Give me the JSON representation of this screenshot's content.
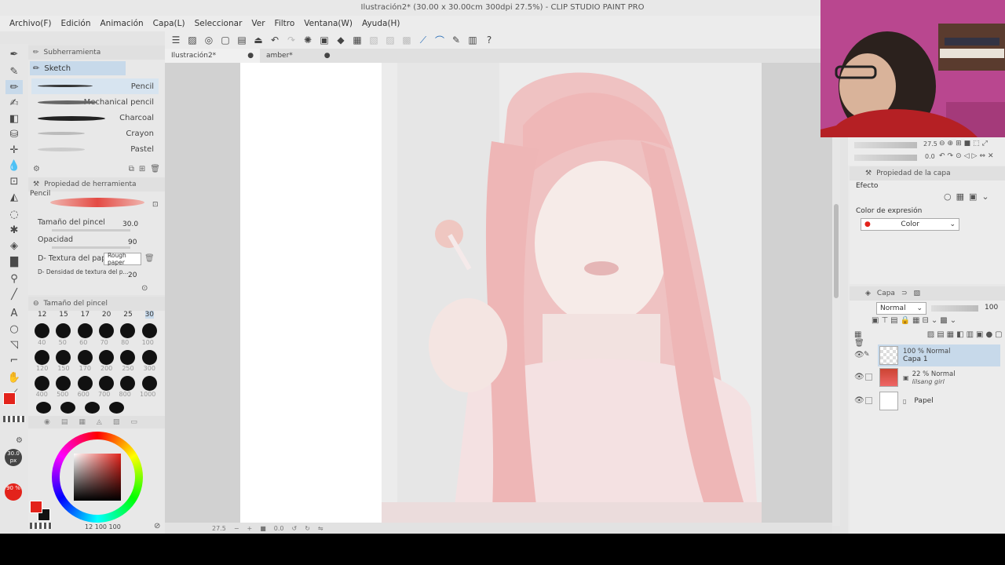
{
  "window": {
    "title": "Ilustración2* (30.00 x 30.00cm 300dpi 27.5%)  - CLIP STUDIO PAINT PRO"
  },
  "menu": [
    "Archivo(F)",
    "Edición",
    "Animación",
    "Capa(L)",
    "Seleccionar",
    "Ver",
    "Filtro",
    "Ventana(W)",
    "Ayuda(H)"
  ],
  "doc_tabs": [
    {
      "label": "Ilustración2*",
      "active": true
    },
    {
      "label": "amber*",
      "active": false
    }
  ],
  "subtool": {
    "header": "Subherramienta",
    "group": "Sketch",
    "brushes": [
      "Pencil",
      "Mechanical pencil",
      "Charcoal",
      "Crayon",
      "Pastel"
    ],
    "selected": "Pencil"
  },
  "tool_property": {
    "header": "Propiedad de herramienta",
    "tool_name": "Pencil",
    "brush_size_label": "Tamaño del pincel",
    "brush_size_value": "30.0",
    "opacity_label": "Opacidad",
    "opacity_value": "90",
    "texture_label": "D- Textura del papel",
    "texture_value": "Rough paper",
    "density_label": "D- Densidad de textura del p...",
    "density_value": "20"
  },
  "brush_size_panel": {
    "header": "Tamaño del pincel",
    "top_sizes": [
      "12",
      "15",
      "17",
      "20",
      "25",
      "30"
    ],
    "row_labels": [
      [
        "40",
        "50",
        "60",
        "70",
        "80",
        "100"
      ],
      [
        "120",
        "150",
        "170",
        "200",
        "250",
        "300"
      ],
      [
        "400",
        "500",
        "600",
        "700",
        "800",
        "1000"
      ]
    ]
  },
  "color_panel": {
    "size_indicator": "30.0 px",
    "opacity_indicator": "90 %",
    "bottom_values": "12  100  100",
    "main_color": "#e3231b",
    "sub_color": "#111111"
  },
  "canvas": {
    "zoom": "27.5",
    "angle": "0.0"
  },
  "navigator": {
    "zoom": "27.5",
    "angle": "0.0"
  },
  "layer_property": {
    "header": "Propiedad de la capa",
    "effect_label": "Efecto",
    "expression_label": "Color de expresión",
    "expression_value": "Color"
  },
  "layers": {
    "header": "Capa",
    "blend_mode": "Normal",
    "opacity": "100",
    "items": [
      {
        "mode": "100 % Normal",
        "name": "Capa 1",
        "selected": true
      },
      {
        "mode": "22 % Normal",
        "name": "lilsang girl",
        "selected": false
      },
      {
        "mode": "",
        "name": "Papel",
        "selected": false
      }
    ]
  },
  "colors": {
    "accent": "#2a6fb8",
    "selection": "#c7d9ea",
    "main_red": "#e3231b"
  }
}
